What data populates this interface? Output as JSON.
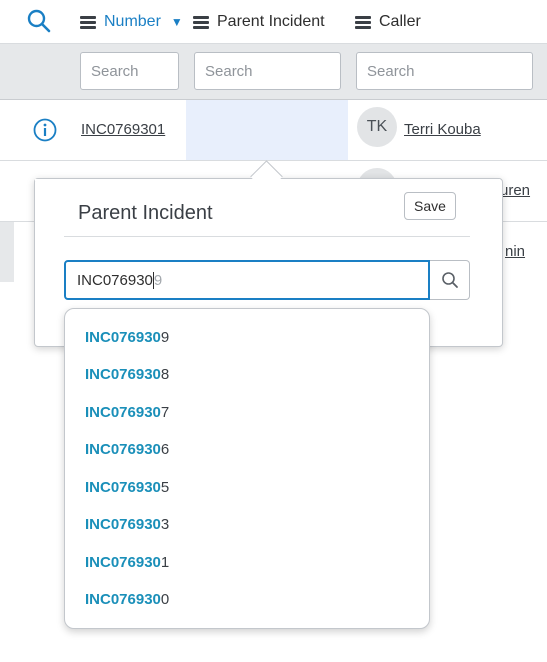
{
  "header": {
    "columns": [
      {
        "label": "Number",
        "sorted": "desc"
      },
      {
        "label": "Parent Incident"
      },
      {
        "label": "Caller"
      }
    ]
  },
  "filters": {
    "number_placeholder": "Search",
    "parent_placeholder": "Search",
    "caller_placeholder": "Search"
  },
  "rows": [
    {
      "number": "INC0769301",
      "caller_initials": "TK",
      "caller": "Terri Kouba"
    },
    {
      "caller_partial": "uren"
    },
    {
      "caller_partial": "nin"
    }
  ],
  "popover": {
    "title": "Parent Incident",
    "save_label": "Save",
    "input_typed": "INC076930",
    "input_suggestion_tail": "9"
  },
  "suggestions": [
    {
      "match": "INC076930",
      "rest": "9"
    },
    {
      "match": "INC076930",
      "rest": "8"
    },
    {
      "match": "INC076930",
      "rest": "7"
    },
    {
      "match": "INC076930",
      "rest": "6"
    },
    {
      "match": "INC076930",
      "rest": "5"
    },
    {
      "match": "INC076930",
      "rest": "3"
    },
    {
      "match": "INC076930",
      "rest": "1"
    },
    {
      "match": "INC076930",
      "rest": "0"
    }
  ],
  "colors": {
    "accent": "#1a7fc4",
    "suggestion_match": "#1a8fb9",
    "selected_cell": "#e8effc"
  }
}
